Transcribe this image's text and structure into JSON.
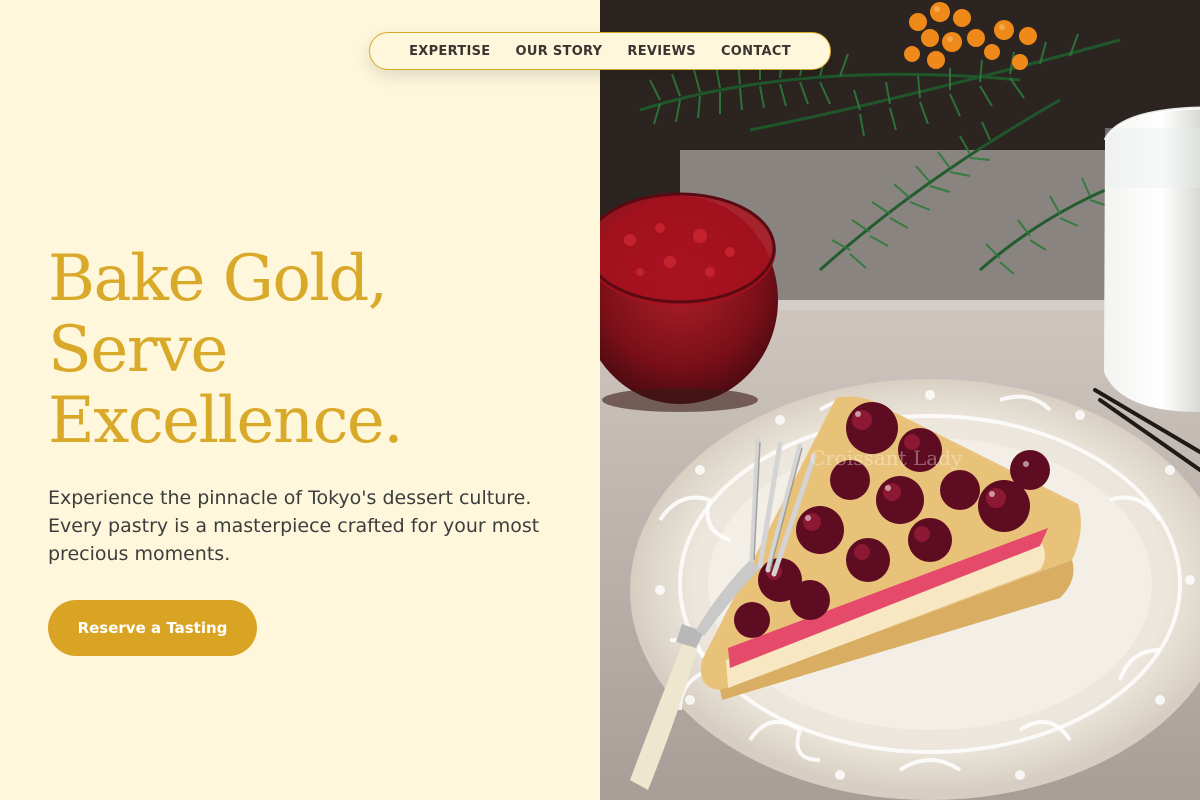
{
  "nav": {
    "items": [
      {
        "label": "EXPERTISE"
      },
      {
        "label": "OUR STORY"
      },
      {
        "label": "REVIEWS"
      },
      {
        "label": "CONTACT"
      }
    ]
  },
  "hero": {
    "headline_lines": [
      "Bake Gold,",
      "Serve",
      "Excellence."
    ],
    "subtext": "Experience the pinnacle of Tokyo's dessert culture. Every pastry is a masterpiece crafted for your most precious moments.",
    "cta_label": "Reserve a Tasting",
    "image_watermark": "Croissant Lady"
  },
  "colors": {
    "background": "#FEF7DC",
    "accent_gold": "#D9A92A",
    "button": "#D9A424",
    "text_dark": "#3d3d3d"
  }
}
